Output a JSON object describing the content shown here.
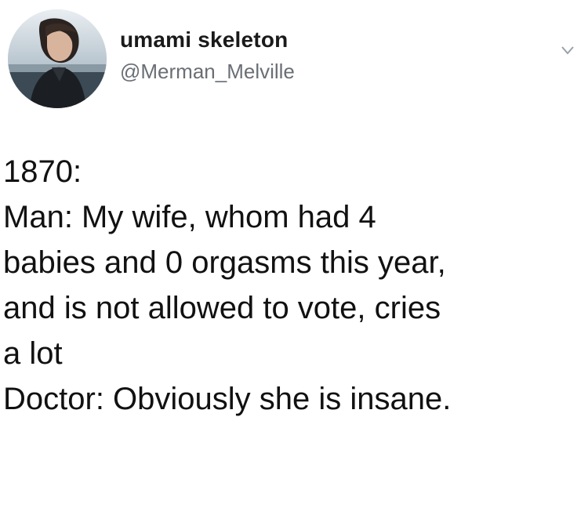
{
  "tweet": {
    "author": {
      "display_name": "umami skeleton",
      "handle": "@Merman_Melville",
      "avatar_icon": "profile-photo"
    },
    "menu_icon": "chevron-down-icon",
    "text_lines": [
      "1870:",
      "Man: My wife, whom had 4",
      "babies and 0 orgasms this year,",
      "and is not allowed to vote, cries",
      "a lot",
      "Doctor: Obviously she is insane."
    ]
  },
  "colors": {
    "background": "#ffffff",
    "text": "#111111",
    "handle": "#6a6f75"
  }
}
